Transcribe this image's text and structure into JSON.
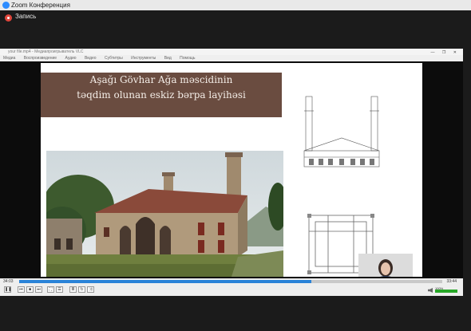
{
  "zoom": {
    "window_title": "Zoom Конференция",
    "recording_label": "Запись"
  },
  "player": {
    "title_text": "your file.mp4 - Медиапроигрыватель VLC",
    "window_controls": "— ❐ ✕",
    "menu": [
      "Медиа",
      "Воспроизведение",
      "Аудио",
      "Видео",
      "Субтитры",
      "Инструменты",
      "Вид",
      "Помощь"
    ],
    "time_elapsed": "34:03",
    "time_total": "33:44",
    "progress_fraction": 0.69,
    "volume_percent_label": "100%",
    "volume_fraction": 1.0,
    "buttons": {
      "play": "❚❚",
      "prev": "⏮",
      "stop": "■",
      "next": "⏭",
      "fullscreen": "⛶",
      "extended": "☰",
      "playlist": "≣",
      "loop": "↻",
      "random": "⤨"
    },
    "colors": {
      "seek": "#2a83d8",
      "volume": "#28a828"
    }
  },
  "slide": {
    "title_line1": "Aşağı Gövhar Ağa məscidinin",
    "title_line2": "təqdim olunan eskiz bərpa layihəsi",
    "title_band_color": "#6a4c40"
  }
}
